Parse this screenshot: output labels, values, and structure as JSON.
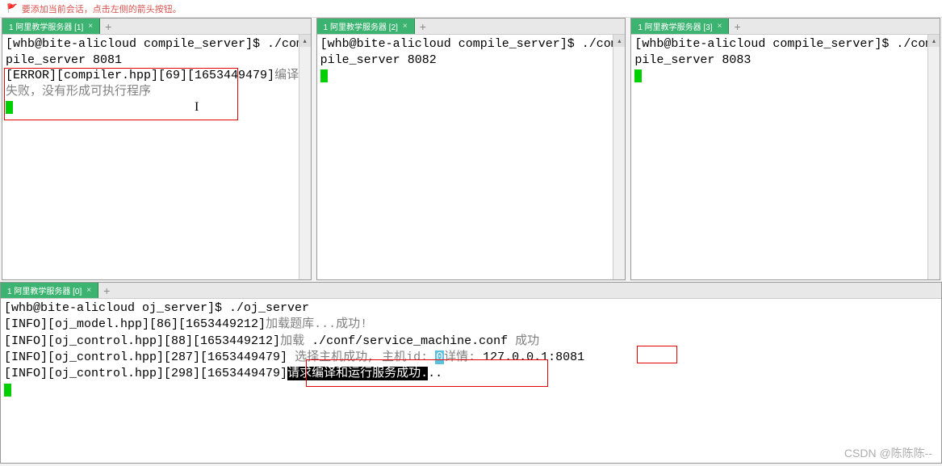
{
  "top_hint": {
    "flag": "🚩",
    "text": "要添加当前会话，点击左侧的箭头按钮。"
  },
  "panes": [
    {
      "tab_label": "1 阿里教学服务器 [1]",
      "lines": [
        "[whb@bite-alicloud compile_server]$ ./compile_server 8081",
        "[ERROR][compiler.hpp][69][1653449479]编译失败，没有形成可执行程序"
      ]
    },
    {
      "tab_label": "1 阿里教学服务器 [2]",
      "lines": [
        "[whb@bite-alicloud compile_server]$ ./compile_server 8082"
      ]
    },
    {
      "tab_label": "1 阿里教学服务器 [3]",
      "lines": [
        "[whb@bite-alicloud compile_server]$ ./compile_server 8083"
      ]
    }
  ],
  "bottom": {
    "tab_label": "1 阿里教学服务器 [0]",
    "prompt_line": "[whb@bite-alicloud oj_server]$ ./oj_server",
    "log1_prefix": "[INFO][oj_model.hpp][86][1653449212]",
    "log1_cn": "加载题库...成功!",
    "log2_prefix": "[INFO][oj_control.hpp][88][1653449212]",
    "log2_cn_a": "加载",
    "log2_mid": " ./conf/service_machine.conf ",
    "log2_cn_b": "成功",
    "log3_prefix": "[INFO][oj_control.hpp][287][1653449479]",
    "log3_cn_a": " 选择主机成功, 主机id: ",
    "log3_id": "0",
    "log3_cn_b": "详情: ",
    "log3_ip": "127.0.0.1:8081",
    "log4_prefix": "[INFO][oj_control.hpp][298][1653449479]",
    "log4_hl": "请求编译和运行服务成功.",
    "log4_tail": ".."
  },
  "icons": {
    "close_x": "×",
    "add_plus": "+",
    "arrow_up": "▴",
    "arrow_down": "▾"
  },
  "watermark": "CSDN @陈陈陈--"
}
